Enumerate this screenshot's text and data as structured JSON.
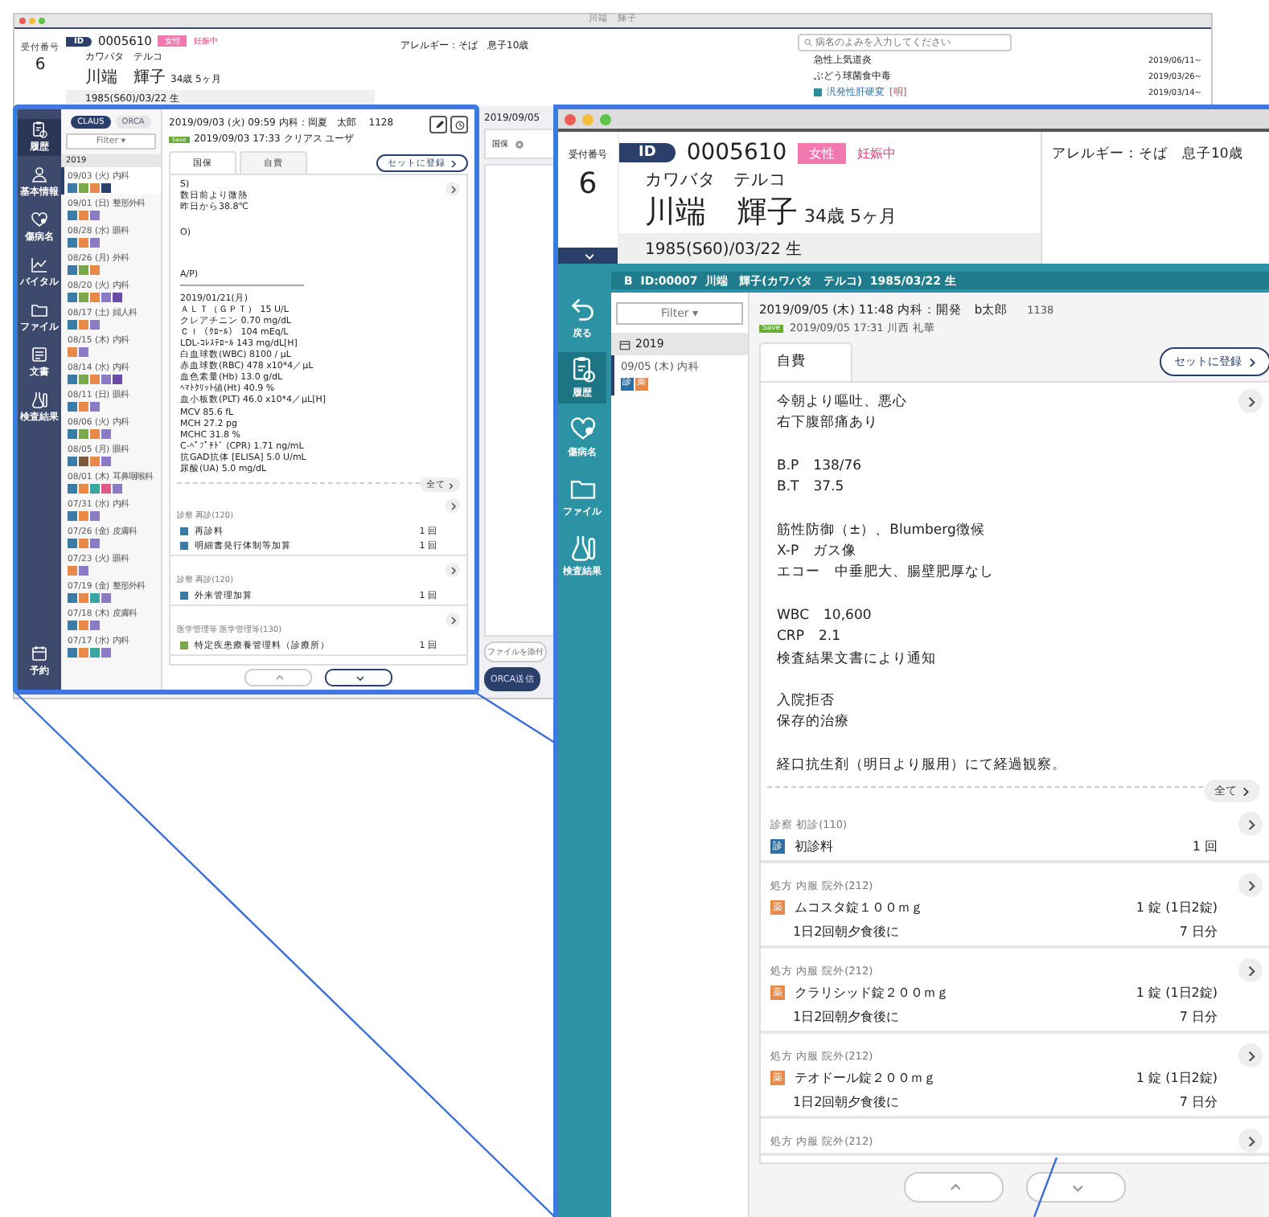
{
  "background_window": {
    "title": "川端　輝子",
    "patient": {
      "reception_label": "受付番号",
      "reception_no": "6",
      "id_label": "ID",
      "id": "0005610",
      "sex": "女性",
      "status": "妊娠中",
      "kana": "カワバタ　テルコ",
      "name": "川端　輝子",
      "age": "34歳 5ヶ月",
      "birth": "1985(S60)/03/22 生"
    },
    "allergy": "アレルギー：そば　息子10歳",
    "disease_search": {
      "placeholder": "病名のよみを入力してください"
    },
    "diseases": [
      {
        "name": "急性上気道炎",
        "date": "2019/06/11~",
        "flagged": false
      },
      {
        "name": "ぶどう球菌食中毒",
        "date": "2019/03/26~",
        "flagged": false
      },
      {
        "name": "汎発性肝硬変",
        "mark": "[明]",
        "date": "2019/03/14~",
        "flagged": true
      }
    ],
    "side_column": {
      "date": "2019/09/05",
      "tab": "国保",
      "attach_button": "ファイルを添付",
      "send_button": "ORCA送信"
    }
  },
  "zoom_left": {
    "sidebar": [
      {
        "kind": "history",
        "label": "履歴",
        "selected": true
      },
      {
        "kind": "person",
        "label": "基本情報",
        "selected": false
      },
      {
        "kind": "heart",
        "label": "傷病名",
        "selected": false
      },
      {
        "kind": "chart",
        "label": "バイタル",
        "selected": false
      },
      {
        "kind": "folder",
        "label": "ファイル",
        "selected": false
      },
      {
        "kind": "doc",
        "label": "文書",
        "selected": false
      },
      {
        "kind": "flask",
        "label": "検査結果",
        "selected": false
      },
      {
        "kind": "calendar",
        "label": "予約",
        "selected": false
      }
    ],
    "toggles": [
      {
        "label": "CLAUS",
        "selected": true
      },
      {
        "label": "ORCA",
        "selected": false
      }
    ],
    "filter": "Filter ▾",
    "year": "2019",
    "visits": [
      {
        "label": "09/03 (火) 内科",
        "selected": true,
        "tags": [
          {
            "color": "#3a7ca5"
          },
          {
            "color": "#7aa84a"
          },
          {
            "color": "#e8894a"
          },
          {
            "color": "#2b3f6b"
          }
        ]
      },
      {
        "label": "09/01 (日) 整形外科",
        "selected": false,
        "tags": [
          {
            "color": "#3a7ca5"
          },
          {
            "color": "#e8894a"
          },
          {
            "color": "#8b7bc4"
          }
        ]
      },
      {
        "label": "08/28 (水) 眼科",
        "selected": false,
        "tags": [
          {
            "color": "#3a7ca5"
          },
          {
            "color": "#e8894a"
          },
          {
            "color": "#8b7bc4"
          }
        ]
      },
      {
        "label": "08/26 (月) 外科",
        "selected": false,
        "tags": [
          {
            "color": "#3a7ca5"
          },
          {
            "color": "#7aa84a"
          },
          {
            "color": "#e8894a"
          }
        ]
      },
      {
        "label": "08/20 (火) 内科",
        "selected": false,
        "tags": [
          {
            "color": "#3a7ca5"
          },
          {
            "color": "#7aa84a"
          },
          {
            "color": "#e8894a"
          },
          {
            "color": "#8b7bc4"
          },
          {
            "color": "#6a4aa8"
          }
        ]
      },
      {
        "label": "08/17 (土) 婦人科",
        "selected": false,
        "tags": [
          {
            "color": "#3a7ca5"
          },
          {
            "color": "#e8894a"
          },
          {
            "color": "#8b7bc4"
          }
        ]
      },
      {
        "label": "08/15 (木) 内科",
        "selected": false,
        "tags": [
          {
            "color": "#e8894a"
          },
          {
            "color": "#8b7bc4"
          }
        ]
      },
      {
        "label": "08/14 (水) 内科",
        "selected": false,
        "tags": [
          {
            "color": "#3a7ca5"
          },
          {
            "color": "#7aa84a"
          },
          {
            "color": "#e8894a"
          },
          {
            "color": "#8b7bc4"
          },
          {
            "color": "#6a4aa8"
          }
        ]
      },
      {
        "label": "08/11 (日) 眼科",
        "selected": false,
        "tags": [
          {
            "color": "#3a7ca5"
          },
          {
            "color": "#e8894a"
          },
          {
            "color": "#8b7bc4"
          }
        ]
      },
      {
        "label": "08/06 (火) 内科",
        "selected": false,
        "tags": [
          {
            "color": "#3a7ca5"
          },
          {
            "color": "#7aa84a"
          },
          {
            "color": "#e8894a"
          },
          {
            "color": "#8b7bc4"
          }
        ]
      },
      {
        "label": "08/05 (月) 眼科",
        "selected": false,
        "tags": [
          {
            "color": "#3a7ca5"
          },
          {
            "color": "#7a5a3a"
          },
          {
            "color": "#e8894a"
          },
          {
            "color": "#8b7bc4"
          }
        ]
      },
      {
        "label": "08/01 (木) 耳鼻咽喉科",
        "selected": false,
        "tags": [
          {
            "color": "#3a7ca5"
          },
          {
            "color": "#e8894a"
          },
          {
            "color": "#3aa6a0"
          },
          {
            "color": "#e05a8a"
          },
          {
            "color": "#8b7bc4"
          }
        ]
      },
      {
        "label": "07/31 (水) 内科",
        "selected": false,
        "tags": [
          {
            "color": "#3a7ca5"
          },
          {
            "color": "#e8894a"
          },
          {
            "color": "#8b7bc4"
          }
        ]
      },
      {
        "label": "07/26 (金) 皮膚科",
        "selected": false,
        "tags": [
          {
            "color": "#3a7ca5"
          },
          {
            "color": "#e8894a"
          },
          {
            "color": "#8b7bc4"
          }
        ]
      },
      {
        "label": "07/23 (火) 眼科",
        "selected": false,
        "tags": [
          {
            "color": "#e8894a"
          },
          {
            "color": "#8b7bc4"
          }
        ]
      },
      {
        "label": "07/19 (金) 整形外科",
        "selected": false,
        "tags": [
          {
            "color": "#3a7ca5"
          },
          {
            "color": "#e8894a"
          },
          {
            "color": "#3aa6a0"
          },
          {
            "color": "#8b7bc4"
          }
        ]
      },
      {
        "label": "07/18 (木) 皮膚科",
        "selected": false,
        "tags": [
          {
            "color": "#3a7ca5"
          },
          {
            "color": "#e8894a"
          },
          {
            "color": "#8b7bc4"
          }
        ]
      },
      {
        "label": "07/17 (水) 内科",
        "selected": false,
        "tags": [
          {
            "color": "#3a7ca5"
          },
          {
            "color": "#e8894a"
          },
          {
            "color": "#3aa6a0"
          },
          {
            "color": "#8b7bc4"
          }
        ]
      }
    ],
    "record": {
      "header": "2019/09/03 (火) 09:59 内科：岡夏　太郎",
      "card_no": "1128",
      "save_badge": "Save",
      "saved": "2019/09/03 17:33 クリアス ユーザ",
      "tabs": [
        {
          "label": "国保",
          "selected": true
        },
        {
          "label": "自費",
          "selected": false
        }
      ],
      "set_button": "セットに登録",
      "note": [
        [
          "S)",
          "数日前より微熱",
          "昨日から38.8℃"
        ],
        [
          "O)"
        ],
        [
          "A/P)",
          "――――――――――――――",
          "2019/01/21(月)",
          "ＡＬＴ（ＧＰＴ） 15 U/L",
          "クレアチニン 0.70 mg/dL",
          "Ｃｌ（ｸﾛｰﾙ） 104 mEq/L",
          "LDL-ｺﾚｽﾃﾛｰﾙ 143 mg/dL[H]",
          "白血球数(WBC) 8100 / μL",
          "赤血球数(RBC) 478 x10*4／μL",
          "血色素量(Hb) 13.0 g/dL",
          "ﾍﾏﾄｸﾘｯﾄ値(Ht) 40.9 %",
          "血小板数(PLT) 46.0 x10*4／μL[H]",
          "MCV 85.6 fL",
          "MCH 27.2 pg",
          "MCHC 31.8 %",
          "C-ﾍﾟﾌﾟﾁﾄﾞ (CPR) 1.71 ng/mL",
          "抗GAD抗体 [ELISA] 5.0 U/mL",
          "尿酸(UA) 5.0 mg/dL"
        ]
      ],
      "all_button": "全て",
      "orders": [
        {
          "category": "診察 再診(120)",
          "items": [
            {
              "color": "#3a7ca5",
              "name": "再診料",
              "qty": "1 回"
            },
            {
              "color": "#3a7ca5",
              "name": "明細書発行体制等加算",
              "qty": "1 回"
            }
          ]
        },
        {
          "category": "診察 再診(120)",
          "items": [
            {
              "color": "#3a7ca5",
              "name": "外来管理加算",
              "qty": "1 回"
            }
          ]
        },
        {
          "category": "医学管理等 医学管理等(130)",
          "items": [
            {
              "color": "#7aa84a",
              "name": "特定疾患療養管理料（診療所）",
              "qty": "1 回"
            }
          ]
        }
      ]
    }
  },
  "zoom_right": {
    "reception_label": "受付番号",
    "reception_no": "6",
    "id_label": "ID",
    "id": "0005610",
    "sex": "女性",
    "status": "妊娠中",
    "kana": "カワバタ　テルコ",
    "name": "川端　輝子",
    "age": "34歳 5ヶ月",
    "birth": "1985(S60)/03/22 生",
    "allergy": "アレルギー：そば　息子10歳",
    "sidebar": [
      {
        "kind": "back",
        "label": "戻る",
        "selected": false
      },
      {
        "kind": "history",
        "label": "履歴",
        "selected": true
      },
      {
        "kind": "heart",
        "label": "傷病名",
        "selected": false
      },
      {
        "kind": "folder",
        "label": "ファイル",
        "selected": false
      },
      {
        "kind": "flask",
        "label": "検査結果",
        "selected": false
      }
    ],
    "patient_bar": "B  ID:00007  川端　輝子(カワバタ　テルコ)  1985/03/22 生",
    "filter": "Filter ▾",
    "year": "2019",
    "visits": [
      {
        "label": "09/05 (木) 内科",
        "selected": true,
        "tags": [
          {
            "glyph": "診",
            "color": "#2f6ea0"
          },
          {
            "glyph": "薬",
            "color": "#e8894a"
          }
        ]
      }
    ],
    "record": {
      "header": "2019/09/05 (木) 11:48 内科：開発　b太郎",
      "card_no": "1138",
      "save_badge": "Save",
      "saved": "2019/09/05 17:31 川西 礼華",
      "tabs": [
        {
          "label": "自費",
          "selected": true
        }
      ],
      "set_button": "セットに登録",
      "note": [
        [
          "今朝より嘔吐、悪心",
          "右下腹部痛あり"
        ],
        [
          "B.P　138/76",
          "B.T　37.5"
        ],
        [
          "筋性防御（±）、Blumberg徴候",
          "X-P　ガス像",
          "エコー　中垂肥大、腸壁肥厚なし"
        ],
        [
          "WBC　10,600",
          "CRP　2.1",
          "検査結果文書により通知"
        ],
        [
          "入院拒否",
          "保存的治療"
        ],
        [
          "経口抗生剤（明日より服用）にて経過観察。"
        ]
      ],
      "all_button": "全て",
      "orders": [
        {
          "category": "診察 初診(110)",
          "items": [
            {
              "glyph": "診",
              "color": "#2f6ea0",
              "name": "初診料",
              "qty": "1 回"
            }
          ]
        },
        {
          "category": "処方 内服 院外(212)",
          "items": [
            {
              "glyph": "薬",
              "color": "#e8894a",
              "name": "ムコスタ錠１００ｍｇ",
              "qty": "1 錠 (1日2錠)"
            }
          ],
          "usage": {
            "text": "1日2回朝夕食後に",
            "days": "7 日分"
          }
        },
        {
          "category": "処方 内服 院外(212)",
          "items": [
            {
              "glyph": "薬",
              "color": "#e8894a",
              "name": "クラリシッド錠２００ｍｇ",
              "qty": "1 錠 (1日2錠)"
            }
          ],
          "usage": {
            "text": "1日2回朝夕食後に",
            "days": "7 日分"
          }
        },
        {
          "category": "処方 内服 院外(212)",
          "items": [
            {
              "glyph": "薬",
              "color": "#e8894a",
              "name": "テオドール錠２００ｍｇ",
              "qty": "1 錠 (1日2錠)"
            }
          ],
          "usage": {
            "text": "1日2回朝夕食後に",
            "days": "7 日分"
          }
        },
        {
          "category": "処方 内服 院外(212)"
        }
      ]
    }
  }
}
